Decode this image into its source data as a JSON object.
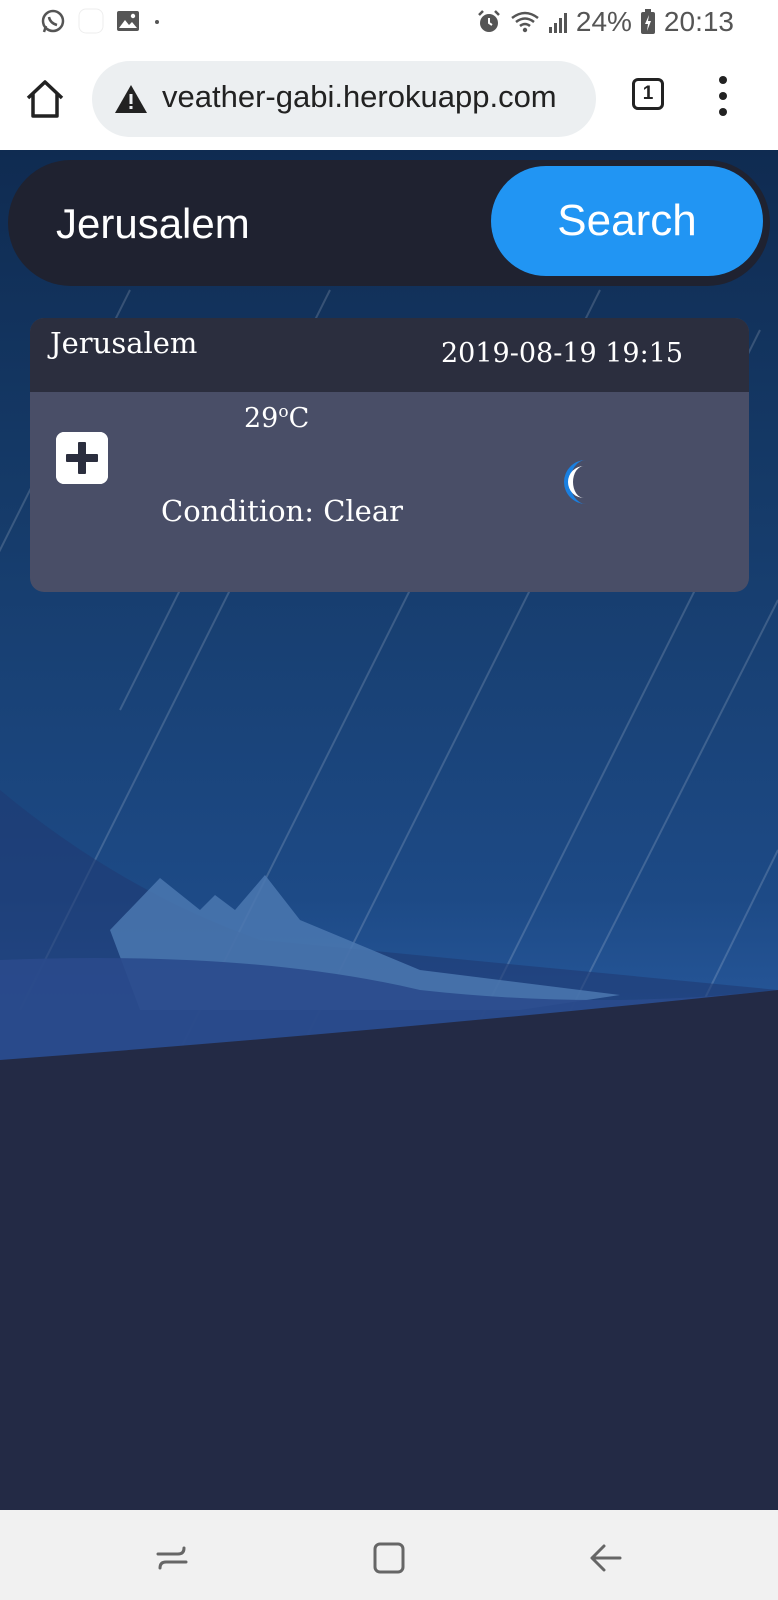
{
  "status_bar": {
    "battery": "24%",
    "time": "20:13",
    "left_icons": [
      "whatsapp-icon",
      "blank-notification-icon",
      "image-icon",
      "dot-icon"
    ],
    "right_icons": [
      "alarm-icon",
      "wifi-icon",
      "signal-icon",
      "battery-icon"
    ]
  },
  "browser": {
    "url": "veather-gabi.herokuapp.com",
    "tab_count": "1",
    "icons": [
      "home-icon",
      "warning-icon",
      "tab-switcher-icon",
      "more-vert-icon"
    ]
  },
  "search": {
    "input_value": "Jerusalem",
    "button_label": "Search"
  },
  "weather_card": {
    "city": "Jerusalem",
    "datetime": "2019-08-19 19:15",
    "temperature": "29",
    "temp_degree": "o",
    "temp_unit": "C",
    "condition": "Condition: Clear",
    "add_icon": "plus-square-icon",
    "condition_icon": "crescent-moon-icon"
  },
  "nav_bar": {
    "icons": [
      "recent-apps-icon",
      "home-nav-icon",
      "back-icon"
    ]
  },
  "colors": {
    "accent": "#2195f3",
    "card_header": "#2b2e3e",
    "card_body": "#494e67",
    "search_bar": "#1f2230",
    "moon": "#1a7fe0"
  }
}
